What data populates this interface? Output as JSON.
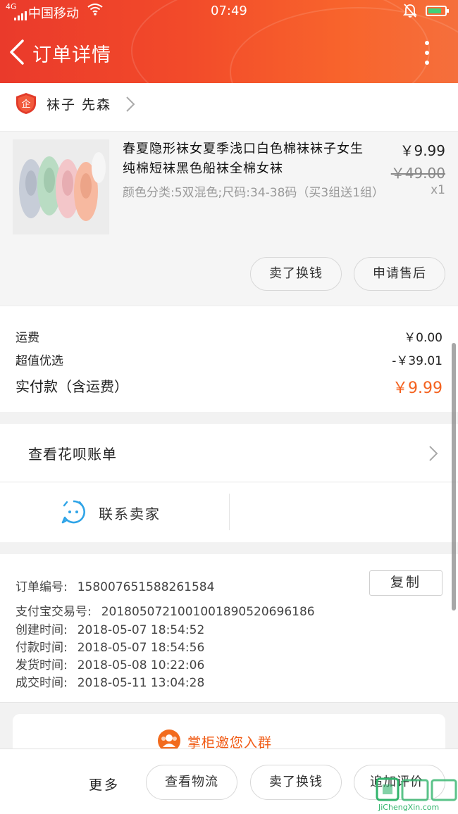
{
  "status_bar": {
    "signal_type": "4G",
    "carrier": "中国移动",
    "time": "07:49"
  },
  "header": {
    "title": "订单详情"
  },
  "shop": {
    "name": "袜子 先森"
  },
  "item": {
    "title": "春夏隐形袜女夏季浅口白色棉袜袜子女生纯棉短袜黑色船袜全棉女袜",
    "spec": "颜色分类:5双混色;尺码:34-38码（买3组送1组）",
    "price": "￥9.99",
    "original_price": "￥49.00",
    "quantity": "x1",
    "sell_button": "卖了换钱",
    "after_sale_button": "申请售后"
  },
  "summary": {
    "shipping_label": "运费",
    "shipping_value": "￥0.00",
    "discount_label": "超值优选",
    "discount_value": "-￥39.01",
    "paid_label": "实付款（含运费）",
    "paid_value": "￥9.99"
  },
  "huabei": {
    "label": "查看花呗账单"
  },
  "contact": {
    "label": "联系卖家"
  },
  "order_info": {
    "copy_button": "复制",
    "rows": [
      {
        "label": "订单编号:",
        "value": "158007651588261584"
      },
      {
        "label": "支付宝交易号:",
        "value": "2018050721001001890520696186"
      },
      {
        "label": "创建时间:",
        "value": "2018-05-07 18:54:52"
      },
      {
        "label": "付款时间:",
        "value": "2018-05-07 18:54:56"
      },
      {
        "label": "发货时间:",
        "value": "2018-05-08 10:22:06"
      },
      {
        "label": "成交时间:",
        "value": "2018-05-11 13:04:28"
      }
    ]
  },
  "group": {
    "label": "掌柜邀您入群"
  },
  "bottom_bar": {
    "more": "更多",
    "logistics": "查看物流",
    "sell": "卖了换钱",
    "review": "追加评价"
  },
  "watermark": {
    "site": "JiChengXin.com"
  },
  "colors": {
    "accent": "#f4621f",
    "header_start": "#ea3a2b",
    "header_end": "#f56f3c"
  }
}
